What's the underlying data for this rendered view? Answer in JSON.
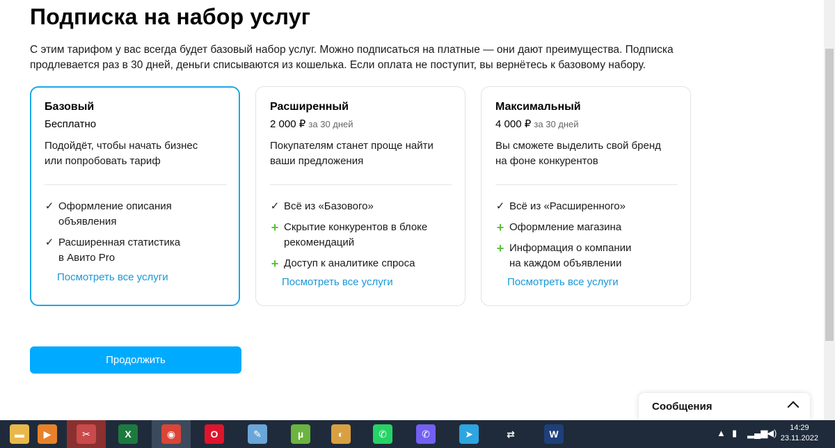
{
  "page": {
    "title": "Подписка на набор услуг",
    "intro_line1": "С этим тарифом у вас всегда будет базовый набор услуг. Можно подписаться на платные — они дают преимущества. Подписка",
    "intro_line2": "продлевается раз в 30 дней, деньги списываются из кошелька. Если оплата не поступит, вы вернётесь к базовому набору."
  },
  "plans": [
    {
      "name": "Базовый",
      "price": "Бесплатно",
      "period": "",
      "desc_line1": "Подойдёт, чтобы начать бизнес",
      "desc_line2": "или попробовать тариф",
      "features": [
        {
          "type": "check",
          "line1": "Оформление описания",
          "line2": "объявления"
        },
        {
          "type": "check",
          "line1": "Расширенная статистика",
          "line2": "в Авито Pro"
        }
      ],
      "see_all": "Посмотреть все услуги"
    },
    {
      "name": "Расширенный",
      "price": "2 000 ₽",
      "period": "за 30 дней",
      "desc_line1": "Покупателям станет проще найти",
      "desc_line2": "ваши предложения",
      "features": [
        {
          "type": "check",
          "line1": "Всё из «Базового»",
          "line2": ""
        },
        {
          "type": "plus",
          "line1": "Скрытие конкурентов в блоке",
          "line2": "рекомендаций"
        },
        {
          "type": "plus",
          "line1": "Доступ к аналитике спроса",
          "line2": ""
        }
      ],
      "see_all": "Посмотреть все услуги"
    },
    {
      "name": "Максимальный",
      "price": "4 000 ₽",
      "period": "за 30 дней",
      "desc_line1": "Вы сможете выделить свой бренд",
      "desc_line2": "на фоне конкурентов",
      "features": [
        {
          "type": "check",
          "line1": "Всё из «Расширенного»",
          "line2": ""
        },
        {
          "type": "plus",
          "line1": "Оформление магазина",
          "line2": ""
        },
        {
          "type": "plus",
          "line1": "Информация о компании",
          "line2": "на каждом объявлении"
        }
      ],
      "see_all": "Посмотреть все услуги"
    }
  ],
  "continue_label": "Продолжить",
  "messages_label": "Сообщения",
  "taskbar": {
    "apps": [
      {
        "icon": "explorer-icon",
        "glyph": "▬",
        "color": "#e8b84a"
      },
      {
        "icon": "media-player-icon",
        "glyph": "▶",
        "color": "#e8822a"
      },
      {
        "icon": "paint-icon",
        "glyph": "✂",
        "color": "#c84a4a"
      },
      {
        "icon": "excel-icon",
        "glyph": "X",
        "color": "#1d7a3e"
      },
      {
        "icon": "chrome-icon",
        "glyph": "◉",
        "color": "#db4437"
      },
      {
        "icon": "opera-icon",
        "glyph": "O",
        "color": "#e0142c"
      },
      {
        "icon": "notepad-icon",
        "glyph": "✎",
        "color": "#6aa6d8"
      },
      {
        "icon": "utorrent-icon",
        "glyph": "µ",
        "color": "#6cb33f"
      },
      {
        "icon": "palette-icon",
        "glyph": "◐",
        "color": "#d8a040"
      },
      {
        "icon": "whatsapp-icon",
        "glyph": "✆",
        "color": "#25d366"
      },
      {
        "icon": "viber-icon",
        "glyph": "✆",
        "color": "#7360f2"
      },
      {
        "icon": "telegram-icon",
        "glyph": "➤",
        "color": "#2ca5e0"
      },
      {
        "icon": "shuffle-icon",
        "glyph": "⇄",
        "color": "#1f2b3a"
      },
      {
        "icon": "word-icon",
        "glyph": "W",
        "color": "#1f3f7a"
      }
    ],
    "time": "14:29",
    "date": "23.11.2022"
  }
}
